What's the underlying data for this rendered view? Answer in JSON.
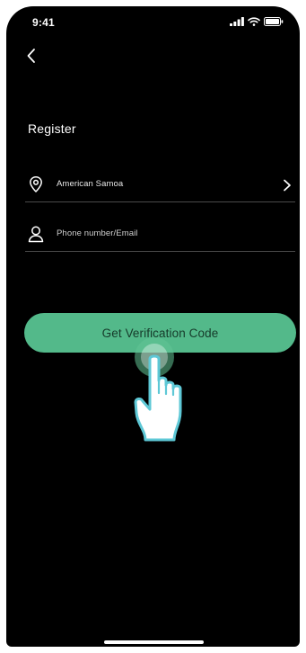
{
  "status_bar": {
    "time": "9:41",
    "signal_icon": "signal-bars-icon",
    "wifi_icon": "wifi-icon",
    "battery_icon": "battery-icon"
  },
  "header": {
    "back_icon": "chevron-left-icon"
  },
  "page": {
    "title": "Register"
  },
  "form": {
    "region": {
      "icon": "location-pin-icon",
      "value": "American Samoa",
      "chevron_icon": "chevron-right-icon"
    },
    "contact": {
      "icon": "user-icon",
      "placeholder": "Phone number/Email",
      "value": ""
    },
    "submit_label": "Get Verification Code"
  },
  "overlay": {
    "hand_icon": "tap-hand-icon"
  },
  "colors": {
    "background": "#000000",
    "accent": "#53b98a",
    "button_text": "#163a2a",
    "divider": "#4a4a4a",
    "hand_outline": "#5ec8d6"
  }
}
